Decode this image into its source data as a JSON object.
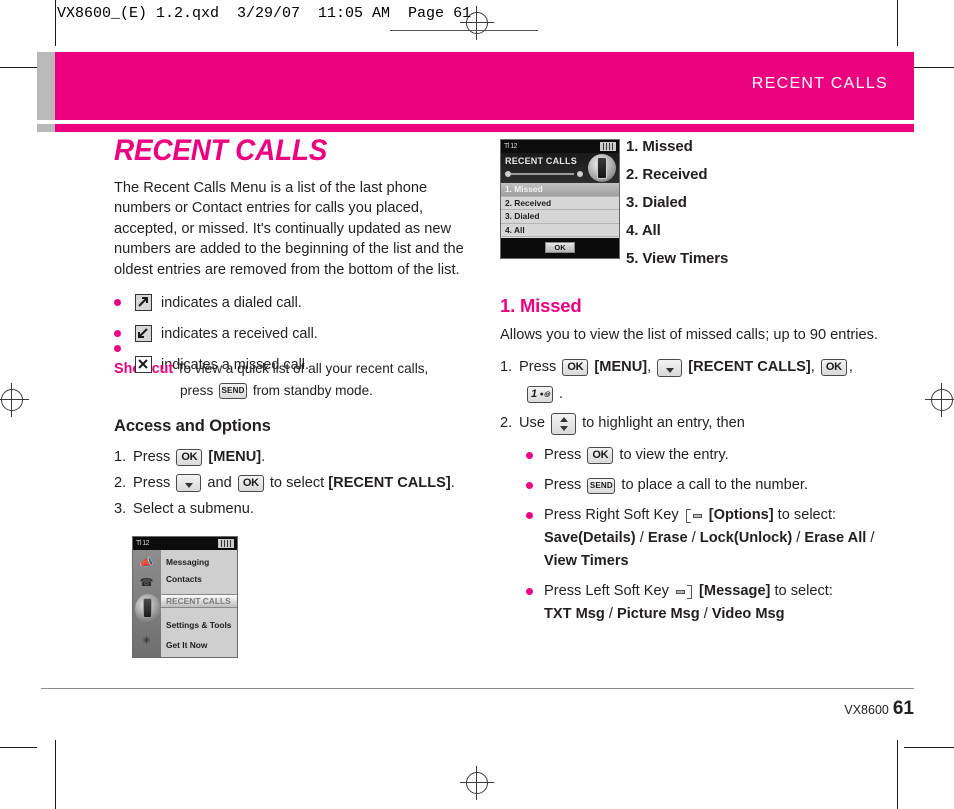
{
  "print_header": {
    "text": "VX8600_(E) 1.2.qxd  3/29/07  11:05 AM  Page 61"
  },
  "running_head": {
    "title": "RECENT CALLS",
    "bar_color": "#ec0080",
    "tab_color": "#b9b9b9"
  },
  "left_column": {
    "chapter_title": "RECENT CALLS",
    "intro": "The Recent Calls Menu is a list of the last phone numbers or Contact entries for calls you placed, accepted, or missed. It's continually updated as new numbers are added to the beginning of the list and the oldest entries are removed from the bottom of the list.",
    "icon_items": [
      {
        "icon": "dialed-call-icon",
        "text": "indicates a dialed call."
      },
      {
        "icon": "received-call-icon",
        "text": "indicates a received call."
      },
      {
        "icon": "missed-call-icon",
        "text": "indicates a missed call."
      }
    ],
    "shortcut": {
      "label": "Shortcut",
      "line1": "To view a quick list of all your recent calls,",
      "line2_pre": "press",
      "key": "SEND",
      "line2_post": "from standby mode."
    },
    "section_heading": "Access and Options",
    "steps": [
      {
        "num": "1.",
        "parts": [
          {
            "t": "text",
            "v": "Press "
          },
          {
            "t": "key",
            "v": "OK"
          },
          {
            "t": "bold",
            "v": "[MENU]"
          },
          {
            "t": "text",
            "v": "."
          }
        ]
      },
      {
        "num": "2.",
        "parts": [
          {
            "t": "text",
            "v": "Press "
          },
          {
            "t": "key-down",
            "v": ""
          },
          {
            "t": "text",
            "v": " and "
          },
          {
            "t": "key",
            "v": "OK"
          },
          {
            "t": "text",
            "v": " to select "
          },
          {
            "t": "bold",
            "v": "[RECENT CALLS]"
          },
          {
            "t": "text",
            "v": "."
          }
        ]
      },
      {
        "num": "3.",
        "parts": [
          {
            "t": "text",
            "v": "Select a submenu."
          }
        ]
      }
    ],
    "screenshot_main_menu": {
      "status_signal": "Tl 12",
      "rail_icons": [
        "speaker-icon",
        "phone-icon",
        "handset-icon",
        "tools-icon",
        "arrow-icon"
      ],
      "items": [
        "Messaging",
        "Contacts",
        "Settings & Tools",
        "Get It Now"
      ],
      "selected_item": "RECENT CALLS"
    }
  },
  "right_column": {
    "screenshot_recent_calls": {
      "title": "RECENT CALLS",
      "items": [
        "1. Missed",
        "2. Received",
        "3. Dialed",
        "4. All",
        "5. View Timers"
      ],
      "selected_index": 0,
      "softkey": "OK"
    },
    "menu_list": [
      "1. Missed",
      "2. Received",
      "3. Dialed",
      "4. All",
      "5. View Timers"
    ],
    "section": {
      "heading": "1. Missed",
      "body": "Allows you to view the list of missed calls; up to 90 entries.",
      "steps": [
        {
          "num": "1.",
          "parts": [
            {
              "t": "text",
              "v": "Press "
            },
            {
              "t": "key",
              "v": "OK"
            },
            {
              "t": "bold",
              "v": "[MENU]"
            },
            {
              "t": "text",
              "v": ", "
            },
            {
              "t": "key-down",
              "v": ""
            },
            {
              "t": "text",
              "v": " "
            },
            {
              "t": "bold",
              "v": "[RECENT CALLS]"
            },
            {
              "t": "text",
              "v": ", "
            },
            {
              "t": "key",
              "v": "OK"
            },
            {
              "t": "text",
              "v": ","
            },
            {
              "t": "br",
              "v": ""
            },
            {
              "t": "key-one",
              "v": "1"
            },
            {
              "t": "text",
              "v": " ."
            }
          ]
        },
        {
          "num": "2.",
          "parts": [
            {
              "t": "text",
              "v": "Use "
            },
            {
              "t": "key-updown",
              "v": ""
            },
            {
              "t": "text",
              "v": " to highlight an entry, then"
            }
          ]
        }
      ],
      "bullets": [
        {
          "parts": [
            {
              "t": "text",
              "v": "Press "
            },
            {
              "t": "key",
              "v": "OK"
            },
            {
              "t": "text",
              "v": " to view the entry."
            }
          ]
        },
        {
          "parts": [
            {
              "t": "text",
              "v": "Press "
            },
            {
              "t": "key-send",
              "v": "SEND"
            },
            {
              "t": "text",
              "v": " to place a call to the number."
            }
          ]
        },
        {
          "parts": [
            {
              "t": "text",
              "v": "Press Right Soft Key "
            },
            {
              "t": "softkey-right",
              "v": ""
            },
            {
              "t": "bold",
              "v": "[Options]"
            },
            {
              "t": "text",
              "v": " to select:"
            },
            {
              "t": "br",
              "v": ""
            },
            {
              "t": "bold",
              "v": "Save(Details)"
            },
            {
              "t": "text",
              "v": " / "
            },
            {
              "t": "bold",
              "v": "Erase"
            },
            {
              "t": "text",
              "v": " / "
            },
            {
              "t": "bold",
              "v": "Lock(Unlock)"
            },
            {
              "t": "text",
              "v": " / "
            },
            {
              "t": "bold",
              "v": "Erase All"
            },
            {
              "t": "text",
              "v": " / "
            },
            {
              "t": "br",
              "v": ""
            },
            {
              "t": "bold",
              "v": "View Timers"
            }
          ]
        },
        {
          "parts": [
            {
              "t": "text",
              "v": "Press Left Soft Key "
            },
            {
              "t": "softkey-left",
              "v": ""
            },
            {
              "t": "bold",
              "v": "[Message]"
            },
            {
              "t": "text",
              "v": " to select:"
            },
            {
              "t": "br",
              "v": ""
            },
            {
              "t": "bold",
              "v": "TXT Msg"
            },
            {
              "t": "text",
              "v": " / "
            },
            {
              "t": "bold",
              "v": "Picture Msg"
            },
            {
              "t": "text",
              "v": " / "
            },
            {
              "t": "bold",
              "v": "Video Msg"
            }
          ]
        }
      ]
    }
  },
  "footer": {
    "model": "VX8600",
    "page": "61"
  }
}
